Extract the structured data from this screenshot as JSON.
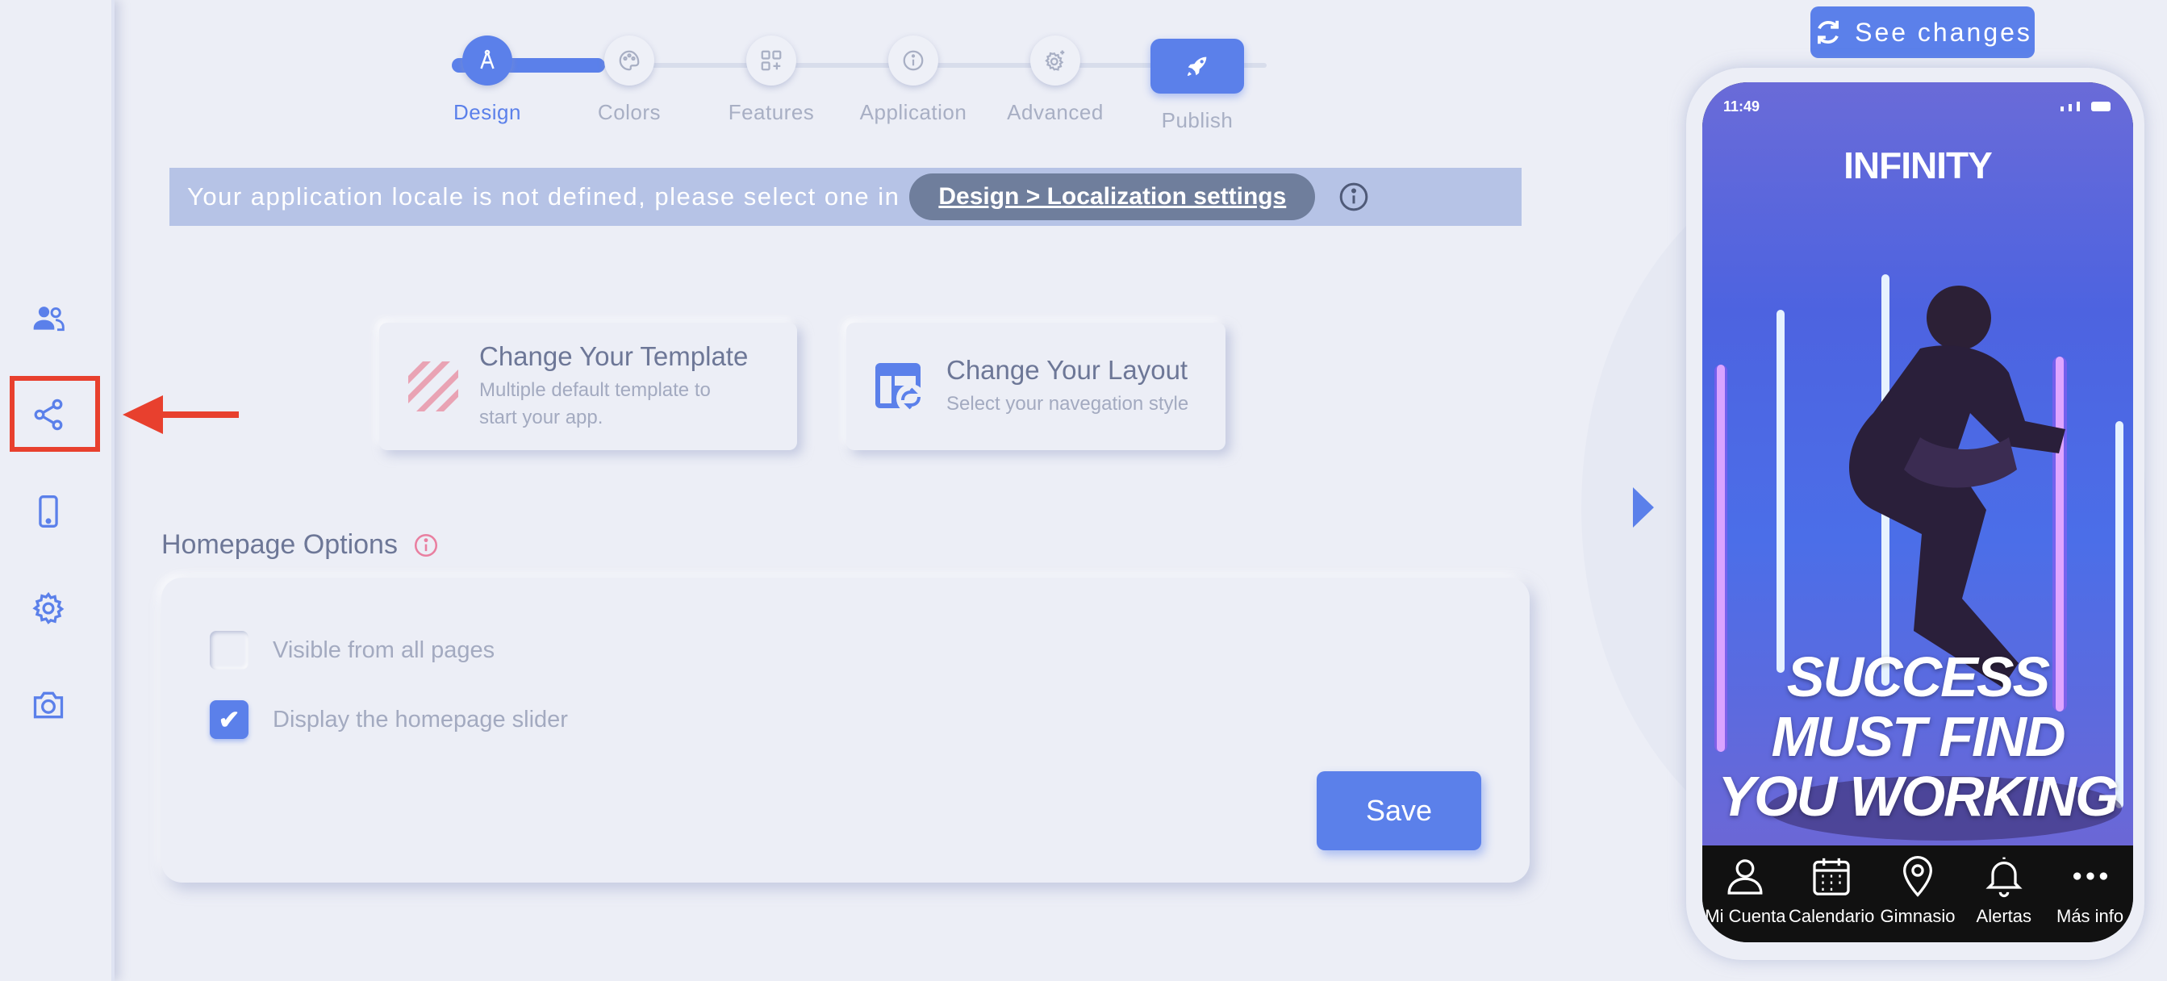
{
  "stepper": {
    "steps": [
      {
        "label": "Design",
        "icon": "compass-icon",
        "active": true
      },
      {
        "label": "Colors",
        "icon": "palette-icon",
        "active": false
      },
      {
        "label": "Features",
        "icon": "grid-plus-icon",
        "active": false
      },
      {
        "label": "Application",
        "icon": "info-icon",
        "active": false
      },
      {
        "label": "Advanced",
        "icon": "gear-sparkle-icon",
        "active": false
      },
      {
        "label": "Publish",
        "icon": "rocket-icon",
        "active": false
      }
    ]
  },
  "banner": {
    "text": "Your application locale is not defined, please select one in",
    "link": "Design > Localization settings"
  },
  "cards": {
    "template": {
      "title": "Change Your Template",
      "subtitle": "Multiple default template to start your app."
    },
    "layout": {
      "title": "Change Your Layout",
      "subtitle": "Select your navegation style"
    }
  },
  "homepage": {
    "title": "Homepage Options",
    "options": [
      {
        "label": "Visible from all pages",
        "checked": false
      },
      {
        "label": "Display the homepage slider",
        "checked": true
      }
    ],
    "save": "Save"
  },
  "preview": {
    "see_changes": "See changes",
    "time": "11:49",
    "brand": "INFINITY",
    "slogan": [
      "SUCCESS",
      "MUST FIND",
      "YOU WORKING"
    ],
    "tabs": [
      {
        "label": "Mi Cuenta",
        "icon": "person-icon"
      },
      {
        "label": "Calendario",
        "icon": "calendar-icon"
      },
      {
        "label": "Gimnasio",
        "icon": "location-pin-icon"
      },
      {
        "label": "Alertas",
        "icon": "bell-icon"
      },
      {
        "label": "Más info",
        "icon": "more-dots-icon"
      }
    ]
  },
  "colors": {
    "accent": "#5b80ea",
    "highlight": "#e8402e",
    "banner": "#b6c3e6"
  }
}
